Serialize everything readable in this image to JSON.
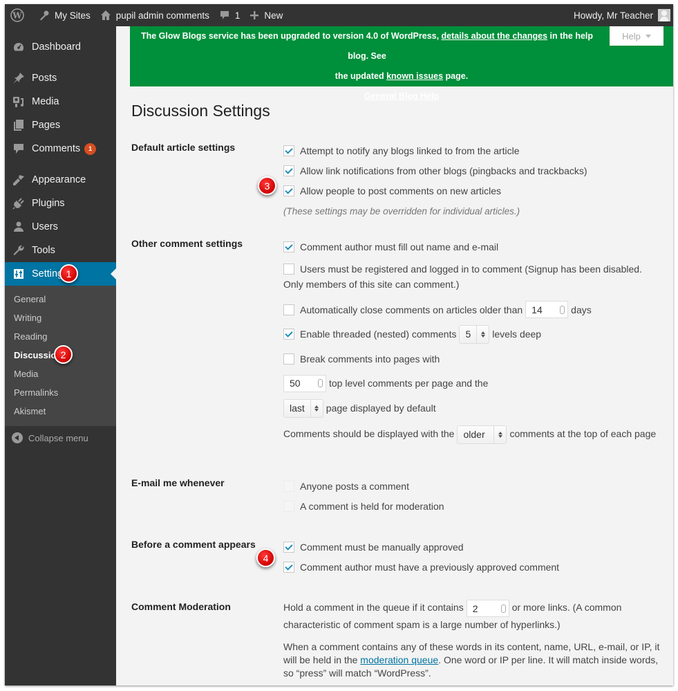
{
  "adminbar": {
    "wp_logo": "wordpress-logo",
    "my_sites": "My Sites",
    "site_name": "pupil admin comments",
    "comments_count": "1",
    "new_label": "New",
    "howdy": "Howdy, Mr Teacher"
  },
  "sidebar": {
    "items": [
      {
        "label": "Dashboard",
        "icon": "dashboard-icon"
      },
      {
        "label": "Posts",
        "icon": "pin-icon"
      },
      {
        "label": "Media",
        "icon": "media-icon"
      },
      {
        "label": "Pages",
        "icon": "pages-icon"
      },
      {
        "label": "Comments",
        "icon": "comment-icon",
        "badge": "1"
      },
      {
        "label": "Appearance",
        "icon": "paintbrush-icon"
      },
      {
        "label": "Plugins",
        "icon": "plugin-icon"
      },
      {
        "label": "Users",
        "icon": "user-icon"
      },
      {
        "label": "Tools",
        "icon": "wrench-icon"
      },
      {
        "label": "Settings",
        "icon": "settings-icon",
        "active": true
      }
    ],
    "submenu": [
      "General",
      "Writing",
      "Reading",
      "Discussion",
      "Media",
      "Permalinks",
      "Akismet"
    ],
    "submenu_current": "Discussion",
    "collapse_label": "Collapse menu"
  },
  "markers": [
    "1",
    "2",
    "3",
    "4"
  ],
  "notice": {
    "line1_pre": "The Glow Blogs service has been upgraded to version 4.0 of WordPress, ",
    "line1_link": "details about the changes",
    "line1_post": " in the help blog. See",
    "line2_pre": "the updated ",
    "line2_link": "known issues",
    "line2_post": " page.",
    "line3_link": "General Blog Help",
    "help_label": "Help",
    "color": "#008f3a"
  },
  "page": {
    "title": "Discussion Settings",
    "sections": {
      "default_article": {
        "label": "Default article settings",
        "options": [
          {
            "label": "Attempt to notify any blogs linked to from the article",
            "checked": true
          },
          {
            "label": "Allow link notifications from other blogs (pingbacks and trackbacks)",
            "checked": true
          },
          {
            "label": "Allow people to post comments on new articles",
            "checked": true
          }
        ],
        "hint": "(These settings may be overridden for individual articles.)"
      },
      "other_comment": {
        "label": "Other comment settings",
        "author_fill": {
          "label": "Comment author must fill out name and e-mail",
          "checked": true
        },
        "registered": {
          "label": "Users must be registered and logged in to comment (Signup has been disabled. Only members of this site can comment.)",
          "checked": false
        },
        "auto_close": {
          "pre": "Automatically close comments on articles older than",
          "value": "14",
          "post": "days",
          "checked": false
        },
        "threaded": {
          "pre": "Enable threaded (nested) comments",
          "value": "5",
          "post": "levels deep",
          "checked": true
        },
        "break_pages": {
          "label": "Break comments into pages with",
          "checked": false
        },
        "per_page": {
          "value": "50",
          "post": "top level comments per page and the"
        },
        "default_page": {
          "value": "last",
          "post": "page displayed by default"
        },
        "order": {
          "pre": "Comments should be displayed with the",
          "value": "older",
          "post": "comments at the top of each page"
        }
      },
      "email_me": {
        "label": "E-mail me whenever",
        "options": [
          {
            "label": "Anyone posts a comment",
            "checked": false
          },
          {
            "label": "A comment is held for moderation",
            "checked": false
          }
        ]
      },
      "before_appears": {
        "label": "Before a comment appears",
        "options": [
          {
            "label": "Comment must be manually approved",
            "checked": true
          },
          {
            "label": "Comment author must have a previously approved comment",
            "checked": true
          }
        ]
      },
      "moderation": {
        "label": "Comment Moderation",
        "hold_pre": "Hold a comment in the queue if it contains",
        "hold_value": "2",
        "hold_post": "or more links. (A common characteristic of comment spam is a large number of hyperlinks.)",
        "words_pre": "When a comment contains any of these words in its content, name, URL, e-mail, or IP, it will be held in the ",
        "words_link": "moderation queue",
        "words_post": ". One word or IP per line. It will match inside words, so “press” will match “WordPress”."
      }
    }
  }
}
